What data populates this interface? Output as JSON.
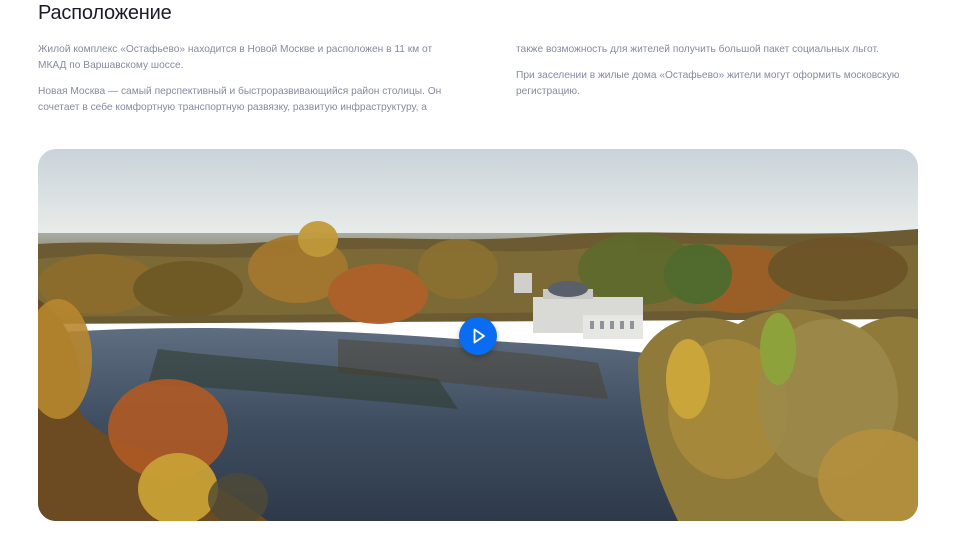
{
  "section": {
    "title": "Расположение"
  },
  "text": {
    "left": [
      "Жилой комплекс «Остафьево» находится в Новой Москве и расположен в 11 км от МКАД по Варшавскому шоссе.",
      "Новая Москва — самый перспективный и быстроразвивающийся район столицы. Он сочетает в себе комфортную транспортную развязку, развитую инфраструктуру, а"
    ],
    "right": [
      "также возможность для жителей получить большой пакет социальных льгот.",
      "При заселении в жилые дома «Остафьево» жители могут оформить московскую регистрацию."
    ]
  },
  "video": {
    "play_icon": "play-icon",
    "accent_color": "#0a6cf0"
  }
}
